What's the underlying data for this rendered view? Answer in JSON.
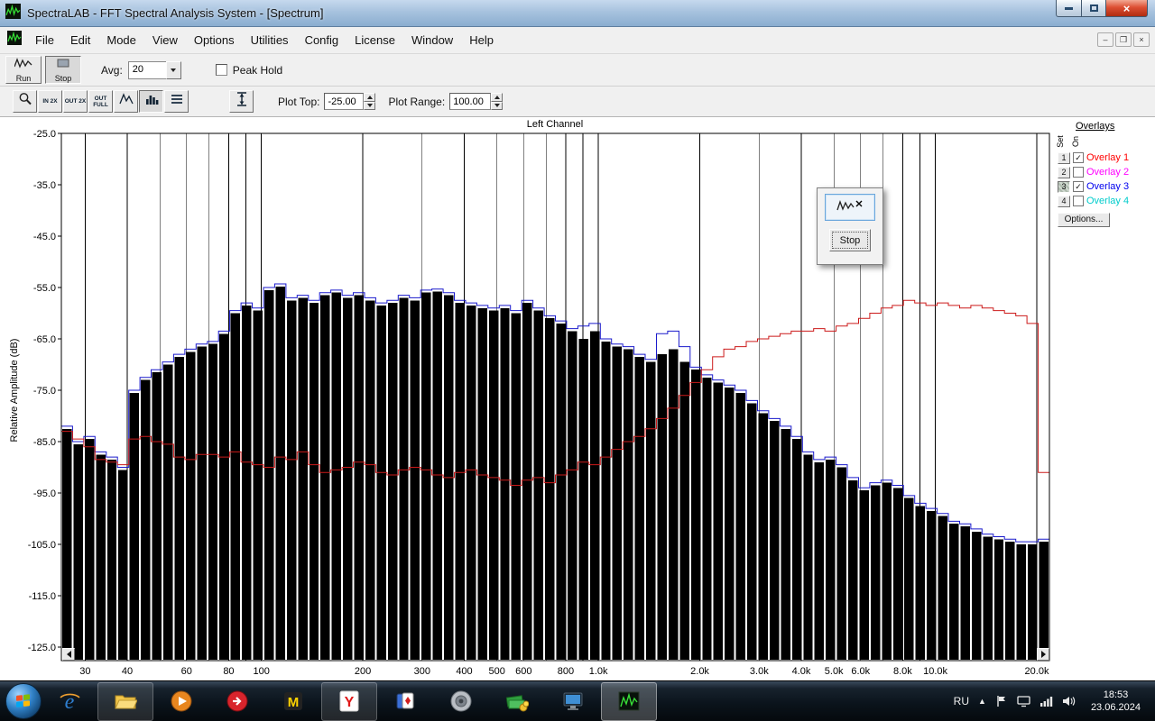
{
  "window": {
    "title": "SpectraLAB - FFT Spectral Analysis System - [Spectrum]"
  },
  "menu": {
    "items": [
      "File",
      "Edit",
      "Mode",
      "View",
      "Options",
      "Utilities",
      "Config",
      "License",
      "Window",
      "Help"
    ]
  },
  "toolbar": {
    "run": "Run",
    "stop": "Stop",
    "avg_label": "Avg:",
    "avg_value": "20",
    "peak_hold": "Peak Hold",
    "zoom_in": "IN 2X",
    "zoom_out": "OUT 2X",
    "zoom_full": "OUT FULL",
    "plot_top_label": "Plot Top:",
    "plot_top_value": "-25.00",
    "plot_range_label": "Plot Range:",
    "plot_range_value": "100.00"
  },
  "floating_panel": {
    "stop": "Stop"
  },
  "overlays": {
    "title": "Overlays",
    "col_set": "Set",
    "col_on": "On",
    "options": "Options...",
    "items": [
      {
        "num": "1",
        "label": "Overlay 1",
        "color": "#ff0000",
        "checked": true
      },
      {
        "num": "2",
        "label": "Overlay 2",
        "color": "#ff00ff",
        "checked": false
      },
      {
        "num": "3",
        "label": "Overlay 3",
        "color": "#0000ee",
        "checked": true
      },
      {
        "num": "4",
        "label": "Overlay 4",
        "color": "#00cccc",
        "checked": false
      }
    ]
  },
  "taskbar": {
    "lang": "RU",
    "time": "18:53",
    "date": "23.06.2024"
  },
  "chart_data": {
    "type": "bar",
    "title": "Left Channel",
    "ylabel": "Relative Amplitude (dB)",
    "ylim": [
      -125,
      -25
    ],
    "y_ticks": [
      -25,
      -35,
      -45,
      -55,
      -65,
      -75,
      -85,
      -95,
      -105,
      -115,
      -125
    ],
    "x_scale": "log",
    "xlim": [
      25.5,
      21800
    ],
    "x_gridlines": [
      30,
      40,
      50,
      60,
      70,
      80,
      90,
      100,
      200,
      300,
      400,
      500,
      600,
      700,
      800,
      900,
      1000,
      2000,
      3000,
      4000,
      5000,
      6000,
      7000,
      8000,
      9000,
      10000,
      20000
    ],
    "x_tick_labels": [
      [
        30,
        "30"
      ],
      [
        40,
        "40"
      ],
      [
        60,
        "60"
      ],
      [
        80,
        "80"
      ],
      [
        100,
        "100"
      ],
      [
        200,
        "200"
      ],
      [
        300,
        "300"
      ],
      [
        400,
        "400"
      ],
      [
        500,
        "500"
      ],
      [
        600,
        "600"
      ],
      [
        800,
        "800"
      ],
      [
        1000,
        "1.0k"
      ],
      [
        2000,
        "2.0k"
      ],
      [
        3000,
        "3.0k"
      ],
      [
        4000,
        "4.0k"
      ],
      [
        5000,
        "5.0k"
      ],
      [
        6000,
        "6.0k"
      ],
      [
        8000,
        "8.0k"
      ],
      [
        10000,
        "10.0k"
      ],
      [
        20000,
        "20.0k"
      ]
    ],
    "frequencies": [
      26,
      28.1,
      30.3,
      32.7,
      35.4,
      38.2,
      41.2,
      44.5,
      48.1,
      51.9,
      56.1,
      60.6,
      65.4,
      70.6,
      76.3,
      82.4,
      89,
      96.1,
      103.8,
      112.1,
      121,
      130.7,
      141.2,
      152.4,
      164.6,
      177.8,
      192,
      207.4,
      224,
      241.9,
      261.2,
      282.1,
      304.7,
      329,
      355.4,
      383.8,
      414.5,
      447.6,
      483.4,
      522.1,
      563.8,
      608.9,
      657.6,
      710.2,
      767,
      828.4,
      894.6,
      966.2,
      1043,
      1127,
      1217,
      1314,
      1420,
      1533,
      1656,
      1788,
      1931,
      2086,
      2253,
      2433,
      2628,
      2838,
      3065,
      3310,
      3575,
      3861,
      4170,
      4503,
      4864,
      5253,
      5673,
      6127,
      6617,
      7146,
      7718,
      8336,
      9003,
      9723,
      10500,
      11340,
      12248,
      13228,
      14286,
      15429,
      16663,
      17996,
      19436,
      20990
    ],
    "series": [
      {
        "name": "spectrum-bars",
        "color": "#000000",
        "values": [
          -82.5,
          -85.5,
          -84.5,
          -87.5,
          -88.5,
          -90.5,
          -75.5,
          -73,
          -71.5,
          -70,
          -68.5,
          -67.5,
          -66.5,
          -66,
          -64,
          -60,
          -58.5,
          -59.5,
          -55.5,
          -54.8,
          -57.5,
          -57,
          -58,
          -56.5,
          -56,
          -57,
          -56.5,
          -57.5,
          -58.5,
          -58,
          -57,
          -57.5,
          -56,
          -55.8,
          -56.5,
          -58,
          -58.5,
          -59,
          -59.5,
          -59,
          -60,
          -58,
          -59.5,
          -61,
          -62,
          -63.5,
          -65,
          -63.5,
          -65.5,
          -66.5,
          -67,
          -68.5,
          -69.5,
          -68,
          -67,
          -69.5,
          -71,
          -72.5,
          -73.5,
          -74.5,
          -75.5,
          -77.5,
          -79.5,
          -81,
          -82.5,
          -84.5,
          -87.5,
          -89,
          -88.5,
          -90,
          -92.5,
          -94.5,
          -93.5,
          -93,
          -94,
          -96,
          -97.5,
          -98.5,
          -99.5,
          -101,
          -101.5,
          -102.5,
          -103.5,
          -104,
          -104.5,
          -105,
          -105,
          -104.5
        ]
      },
      {
        "name": "overlay-3-blue",
        "color": "#1a1acc",
        "values": [
          -82,
          -85,
          -84,
          -87,
          -88,
          -90,
          -75,
          -72.5,
          -71,
          -69.5,
          -68,
          -67,
          -66,
          -65.5,
          -63.5,
          -59.5,
          -58,
          -59,
          -55,
          -54.3,
          -57,
          -56.5,
          -57.5,
          -56,
          -55.5,
          -56.5,
          -56,
          -57,
          -58,
          -57.5,
          -56.5,
          -57,
          -55.5,
          -55.3,
          -56,
          -57.5,
          -58,
          -58.5,
          -59,
          -58.5,
          -59.5,
          -57.5,
          -59,
          -60.5,
          -61.5,
          -63,
          -62.5,
          -62,
          -65,
          -66,
          -66.5,
          -68,
          -69,
          -64,
          -63.5,
          -66.5,
          -70.5,
          -72,
          -73,
          -74,
          -75,
          -77,
          -79,
          -80.5,
          -82,
          -84,
          -87,
          -88.5,
          -88,
          -89.5,
          -92,
          -94,
          -93,
          -92.5,
          -93.5,
          -95.5,
          -97,
          -98,
          -99,
          -100.5,
          -101,
          -102,
          -103,
          -103.5,
          -104,
          -104.5,
          -104.5,
          -104
        ]
      },
      {
        "name": "overlay-1-red",
        "color": "#cc1a1a",
        "values": [
          -83,
          -84.5,
          -86,
          -88.5,
          -89,
          -89.5,
          -84.5,
          -84,
          -85,
          -85.5,
          -88,
          -88.5,
          -87.5,
          -87.5,
          -88,
          -87,
          -89,
          -89.5,
          -90,
          -88,
          -88.5,
          -87,
          -89.5,
          -91,
          -90.5,
          -90,
          -89,
          -89.5,
          -91,
          -91.5,
          -90.5,
          -90,
          -90.5,
          -91.5,
          -92,
          -91,
          -90.5,
          -91.5,
          -92,
          -92.5,
          -93.5,
          -92.5,
          -92,
          -93,
          -91.5,
          -90.5,
          -89,
          -89.5,
          -88,
          -86.5,
          -85,
          -84,
          -82.5,
          -80.5,
          -78.5,
          -76,
          -73.5,
          -71,
          -68.5,
          -67,
          -66.5,
          -65.5,
          -65,
          -64.5,
          -64,
          -63.5,
          -63.5,
          -63,
          -63.5,
          -62.5,
          -62,
          -61,
          -60,
          -59,
          -58.5,
          -57.5,
          -58,
          -58.5,
          -58,
          -58.5,
          -59,
          -58.5,
          -59,
          -59.5,
          -60,
          -60.5,
          -62,
          -91
        ]
      }
    ]
  }
}
